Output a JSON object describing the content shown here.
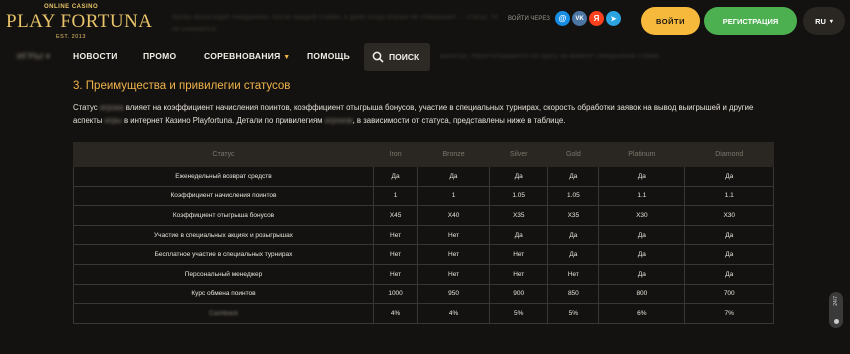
{
  "header": {
    "logo": {
      "top": "ONLINE CASINO",
      "main": "PLAY FORTUNA",
      "est": "EST. 2013"
    },
    "blurred_text": "ерова происходит ежедневно, после каждой ставки, и даже когда игроки не совершают ... статус, то он снижается.",
    "enter_via": "ВОЙТИ ЧЕРЕЗ",
    "socials": [
      {
        "name": "mail",
        "glyph": "@",
        "color": "#168de2"
      },
      {
        "name": "vk",
        "glyph": "VK",
        "color": "#4c75a3"
      },
      {
        "name": "yandex",
        "glyph": "Я",
        "color": "#fc3f1d"
      },
      {
        "name": "telegram",
        "glyph": "➤",
        "color": "#2aa3df"
      }
    ],
    "login_label": "ВОЙТИ",
    "register_label": "РЕГИСТРАЦИЯ",
    "lang": "RU"
  },
  "nav": {
    "games": "ИГРЫ",
    "news": "НОВОСТИ",
    "promo": "ПРОМО",
    "tournaments": "СОРЕВНОВАНИЯ",
    "help": "ПОМОЩЬ",
    "search": "ПОИСК",
    "blurred_text": "валютах, пересчитываются по курсу на момент совершения ставки."
  },
  "content": {
    "title": "3. Преимущества и привилегии статусов",
    "para": {
      "p1": "Статус ",
      "b1": "игрока",
      "p2": " влияет на коэффициент начисления поинтов, коэффициент отыгрыша бонусов, участие в специальных турнирах, скорость обработки заявок на вывод выигрышей и другие аспекты ",
      "b2": "игры",
      "p3": " в интернет Казино Playfortuna. Детали по привилегиям ",
      "b3": "игроков",
      "p4": ", в зависимости от статуса, представлены ниже в таблице."
    }
  },
  "table": {
    "headers": [
      "Статус",
      "Iron",
      "Bronze",
      "Silver",
      "Gold",
      "Platinum",
      "Diamond"
    ],
    "rows": [
      [
        "Еженедельный возврат средств",
        "Да",
        "Да",
        "Да",
        "Да",
        "Да",
        "Да"
      ],
      [
        "Коэффициент начисления поинтов",
        "1",
        "1",
        "1.05",
        "1.05",
        "1.1",
        "1.1"
      ],
      [
        "Коэффициент отыгрыша бонусов",
        "X45",
        "X40",
        "X35",
        "X35",
        "X30",
        "X30"
      ],
      [
        "Участие в специальных акциях и розыгрышах",
        "Нет",
        "Нет",
        "Да",
        "Да",
        "Да",
        "Да"
      ],
      [
        "Бесплатное участие в специальных турнирах",
        "Нет",
        "Нет",
        "Нет",
        "Да",
        "Да",
        "Да"
      ],
      [
        "Персональный менеджер",
        "Нет",
        "Нет",
        "Нет",
        "Нет",
        "Да",
        "Да"
      ],
      [
        "Курс обмена поинтов",
        "1000",
        "950",
        "900",
        "850",
        "800",
        "700"
      ],
      [
        "Cashback",
        "4%",
        "4%",
        "5%",
        "5%",
        "6%",
        "7%"
      ]
    ]
  },
  "chat": {
    "label": "24/7"
  }
}
